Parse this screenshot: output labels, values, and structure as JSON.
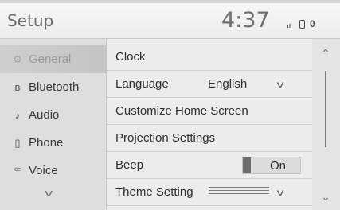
{
  "header": {
    "title": "Setup",
    "time": "4:37",
    "status_number": "0"
  },
  "sidebar": {
    "items": [
      {
        "label": "General",
        "icon": "gear-icon",
        "glyph": "⚙"
      },
      {
        "label": "Bluetooth",
        "icon": "bluetooth-icon",
        "glyph": "ʙ"
      },
      {
        "label": "Audio",
        "icon": "music-note-icon",
        "glyph": "♪"
      },
      {
        "label": "Phone",
        "icon": "phone-icon",
        "glyph": "▯"
      },
      {
        "label": "Voice",
        "icon": "voice-icon",
        "glyph": "ꟹ"
      }
    ],
    "more_glyph": "v"
  },
  "settings": {
    "rows": [
      {
        "label": "Clock"
      },
      {
        "label": "Language",
        "value": "English"
      },
      {
        "label": "Customize Home Screen"
      },
      {
        "label": "Projection Settings"
      },
      {
        "label": "Beep",
        "toggle": "On"
      },
      {
        "label": "Theme Setting"
      }
    ]
  },
  "scroll": {
    "up_glyph": "⌃",
    "down_glyph": "⌄"
  },
  "colors": {
    "background": "#dcdcdc",
    "active_item": "#c8c8c8",
    "knob": "#6d6d6d"
  }
}
